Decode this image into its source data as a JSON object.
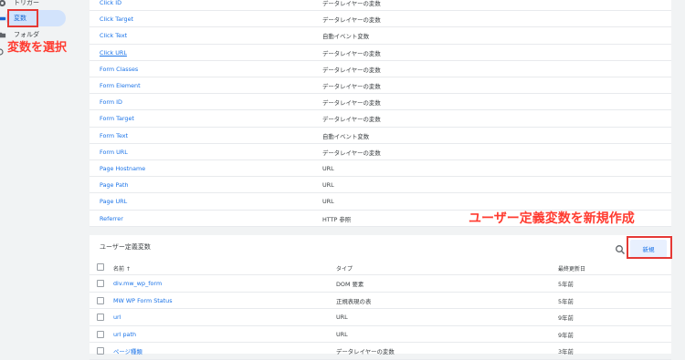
{
  "sidebar": {
    "items": [
      {
        "label": "トリガー",
        "icon": "trigger-icon"
      },
      {
        "label": "変数",
        "icon": "variables-icon"
      },
      {
        "label": "フォルダ",
        "icon": "folder-icon"
      }
    ]
  },
  "annotations": {
    "select_variables": "変数を選択",
    "create_user_variable": "ユーザー定義変数を新規作成"
  },
  "builtin_variables": [
    {
      "name": "Click ID",
      "type": "データレイヤーの変数"
    },
    {
      "name": "Click Target",
      "type": "データレイヤーの変数"
    },
    {
      "name": "Click Text",
      "type": "自動イベント変数"
    },
    {
      "name": "Click URL",
      "type": "データレイヤーの変数"
    },
    {
      "name": "Form Classes",
      "type": "データレイヤーの変数"
    },
    {
      "name": "Form Element",
      "type": "データレイヤーの変数"
    },
    {
      "name": "Form ID",
      "type": "データレイヤーの変数"
    },
    {
      "name": "Form Target",
      "type": "データレイヤーの変数"
    },
    {
      "name": "Form Text",
      "type": "自動イベント変数"
    },
    {
      "name": "Form URL",
      "type": "データレイヤーの変数"
    },
    {
      "name": "Page Hostname",
      "type": "URL"
    },
    {
      "name": "Page Path",
      "type": "URL"
    },
    {
      "name": "Page URL",
      "type": "URL"
    },
    {
      "name": "Referrer",
      "type": "HTTP 参照"
    }
  ],
  "user_variables": {
    "title": "ユーザー定義変数",
    "new_button": "新規",
    "columns": {
      "name": "名前 ↑",
      "type": "タイプ",
      "updated": "最終更新日"
    },
    "rows": [
      {
        "name": "div.mw_wp_form",
        "type": "DOM 要素",
        "updated": "5年前"
      },
      {
        "name": "MW WP Form Status",
        "type": "正規表現の表",
        "updated": "5年前"
      },
      {
        "name": "url",
        "type": "URL",
        "updated": "9年前"
      },
      {
        "name": "url path",
        "type": "URL",
        "updated": "9年前"
      },
      {
        "name": "ページ種類",
        "type": "データレイヤーの変数",
        "updated": "3年前"
      }
    ]
  },
  "colors": {
    "accent": "#1a73e8",
    "annotation": "#ff3b30",
    "highlight": "#e53935"
  }
}
